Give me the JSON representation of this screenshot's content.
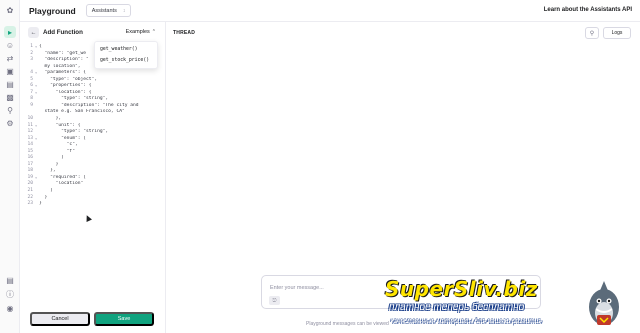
{
  "header": {
    "title": "Playground",
    "mode": "Assistants",
    "learn_link": "Learn about the Assistants API"
  },
  "rail": {
    "icons": [
      "openai-logo-icon",
      "playground-icon",
      "assistants-icon",
      "fine-tuning-icon",
      "storage-icon",
      "batches-icon",
      "usage-icon",
      "api-keys-icon",
      "settings-icon"
    ],
    "bottom_icons": [
      "docs-icon",
      "help-icon",
      "user-avatar"
    ]
  },
  "editor": {
    "title": "Add Function",
    "examples_label": "Examples",
    "examples_options": [
      "get_weather()",
      "get_stock_price()"
    ],
    "lines": [
      {
        "n": "1",
        "fold": "▾",
        "text": "{"
      },
      {
        "n": "2",
        "fold": "",
        "text": "  \"name\": \"get_we"
      },
      {
        "n": "3",
        "fold": "",
        "text": "  \"description\": \""
      },
      {
        "n": "",
        "fold": "",
        "text": "  my location\","
      },
      {
        "n": "4",
        "fold": "▾",
        "text": "  \"parameters\": {"
      },
      {
        "n": "5",
        "fold": "",
        "text": "    \"type\": \"object\","
      },
      {
        "n": "6",
        "fold": "▾",
        "text": "    \"properties\": {"
      },
      {
        "n": "7",
        "fold": "▾",
        "text": "      \"location\": {"
      },
      {
        "n": "8",
        "fold": "",
        "text": "        \"type\": \"string\","
      },
      {
        "n": "9",
        "fold": "",
        "text": "        \"description\": \"The city and"
      },
      {
        "n": "",
        "fold": "",
        "text": "  state e.g. San Francisco, CA\""
      },
      {
        "n": "10",
        "fold": "",
        "text": "      },"
      },
      {
        "n": "11",
        "fold": "▾",
        "text": "      \"unit\": {"
      },
      {
        "n": "12",
        "fold": "",
        "text": "        \"type\": \"string\","
      },
      {
        "n": "13",
        "fold": "▾",
        "text": "        \"enum\": ["
      },
      {
        "n": "14",
        "fold": "",
        "text": "          \"c\","
      },
      {
        "n": "15",
        "fold": "",
        "text": "          \"f\""
      },
      {
        "n": "16",
        "fold": "",
        "text": "        ]"
      },
      {
        "n": "17",
        "fold": "",
        "text": "      }"
      },
      {
        "n": "18",
        "fold": "",
        "text": "    },"
      },
      {
        "n": "19",
        "fold": "▾",
        "text": "    \"required\": ["
      },
      {
        "n": "20",
        "fold": "",
        "text": "      \"location\""
      },
      {
        "n": "21",
        "fold": "",
        "text": "    ]"
      },
      {
        "n": "22",
        "fold": "",
        "text": "  }"
      },
      {
        "n": "23",
        "fold": "",
        "text": "}"
      }
    ],
    "cancel_label": "Cancel",
    "save_label": "Save"
  },
  "thread": {
    "label": "THREAD",
    "logs_label": "Logs",
    "input_placeholder": "Enter your message...",
    "footer_note": "Playground messages can be viewed"
  },
  "watermark": {
    "title": "SuperSliv.biz",
    "subtitle": "платное теперь бесплатно",
    "tagline": "качественные материалы для вашего развития"
  },
  "colors": {
    "accent": "#10a37f",
    "watermark_yellow": "#ffe600",
    "watermark_blue": "#1a3e8a"
  }
}
